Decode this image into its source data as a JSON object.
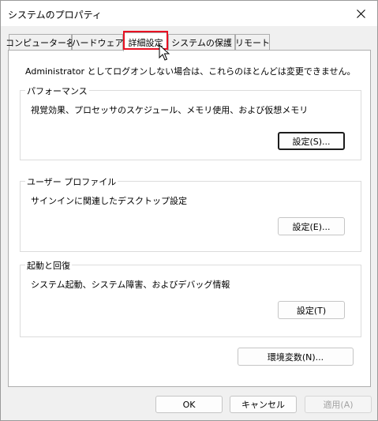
{
  "window": {
    "title": "システムのプロパティ"
  },
  "tabs": [
    {
      "label": "コンピューター名"
    },
    {
      "label": "ハードウェア"
    },
    {
      "label": "詳細設定",
      "active": true
    },
    {
      "label": "システムの保護"
    },
    {
      "label": "リモート"
    }
  ],
  "panel": {
    "notice": "Administrator としてログオンしない場合は、これらのほとんどは変更できません。",
    "performance": {
      "title": "パフォーマンス",
      "description": "視覚効果、プロセッサのスケジュール、メモリ使用、および仮想メモリ",
      "button": "設定(S)..."
    },
    "user_profile": {
      "title": "ユーザー プロファイル",
      "description": "サインインに関連したデスクトップ設定",
      "button": "設定(E)..."
    },
    "startup_recovery": {
      "title": "起動と回復",
      "description": "システム起動、システム障害、およびデバッグ情報",
      "button": "設定(T)"
    },
    "env_button": "環境変数(N)..."
  },
  "footer": {
    "ok": "OK",
    "cancel": "キャンセル",
    "apply": "適用(A)"
  },
  "colors": {
    "tab_highlight": "#e81123",
    "window_bg": "#f0f0f0",
    "panel_bg": "#ffffff"
  },
  "icons": {
    "close": "close-icon",
    "cursor": "mouse-pointer-icon"
  }
}
